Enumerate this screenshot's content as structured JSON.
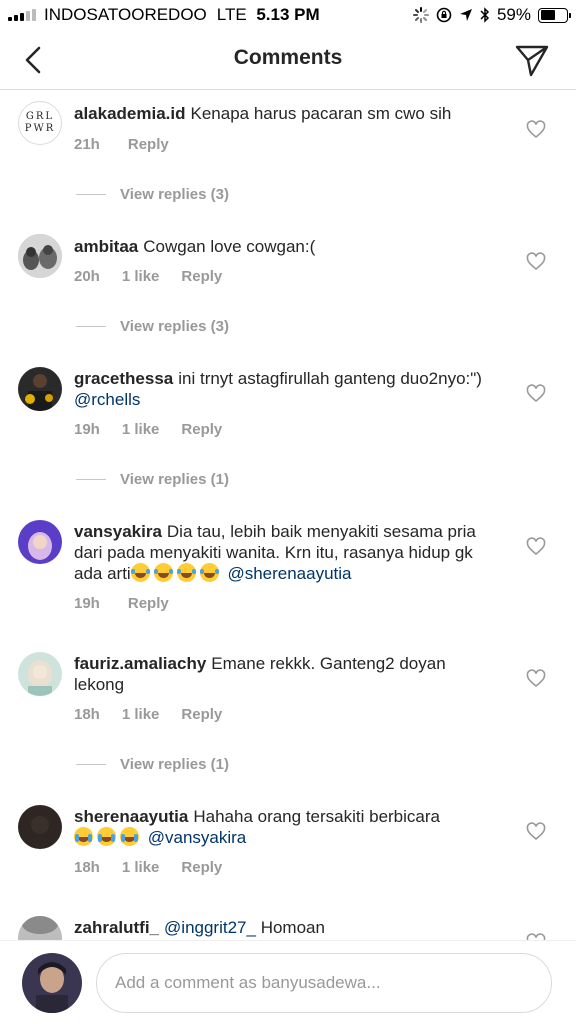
{
  "status_bar": {
    "carrier": "INDOSATOOREDOO",
    "network": "LTE",
    "time": "5.13 PM",
    "battery_percent": "59%",
    "battery_level": 0.59
  },
  "header": {
    "title": "Comments"
  },
  "comments": [
    {
      "username": "alakademia.id",
      "text": "Kenapa harus pacaran sm cwo sih",
      "time": "21h",
      "likes": "",
      "reply": "Reply",
      "view_replies": "View replies (3)",
      "avatar_text": "GRL PWR"
    },
    {
      "username": "ambitaa",
      "text": "Cowgan love cowgan:(",
      "time": "20h",
      "likes": "1 like",
      "reply": "Reply",
      "view_replies": "View replies (3)"
    },
    {
      "username": "gracethessa",
      "text": "ini trnyt astagfirullah ganteng duo2nyo:\")",
      "mention": "@rchells",
      "time": "19h",
      "likes": "1 like",
      "reply": "Reply",
      "view_replies": "View replies (1)"
    },
    {
      "username": "vansyakira",
      "text": "Dia tau, lebih baik menyakiti sesama pria dari pada menyakiti wanita. Krn itu, rasanya hidup gk ada arti",
      "mention": "@sherenaayutia",
      "time": "19h",
      "likes": "",
      "reply": "Reply",
      "view_replies": ""
    },
    {
      "username": "fauriz.amaliachy",
      "text": "Emane rekkk. Ganteng2 doyan lekong",
      "time": "18h",
      "likes": "1 like",
      "reply": "Reply",
      "view_replies": "View replies (1)"
    },
    {
      "username": "sherenaayutia",
      "text": "Hahaha orang tersakiti berbicara",
      "mention": "@vansyakira",
      "time": "18h",
      "likes": "1 like",
      "reply": "Reply",
      "view_replies": ""
    },
    {
      "username": "zahralutfi_",
      "mention": "@inggrit27_",
      "text": "Homoan"
    }
  ],
  "composer": {
    "placeholder": "Add a comment as banyusadewa..."
  },
  "colors": {
    "text": "#262626",
    "meta": "#999999",
    "mention": "#003569",
    "divider": "#dbdbdb"
  }
}
